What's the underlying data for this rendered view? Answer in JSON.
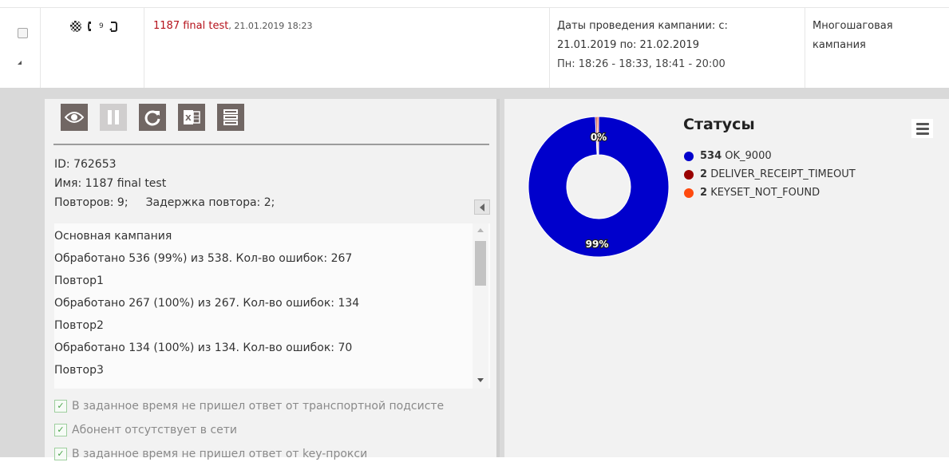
{
  "row": {
    "repeat_icon_count": "9",
    "campaign_name": "1187 final test",
    "campaign_date": "21.01.2019 18:23",
    "dates_line1": "Даты проведения кампании: с:",
    "dates_line2": "21.01.2019 по: 21.02.2019",
    "dates_line3": "Пн: 18:26 - 18:33, 18:41 - 20:00",
    "type_line1": "Многошаговая",
    "type_line2": "кампания"
  },
  "info": {
    "id": "ID: 762653",
    "name": "Имя: 1187 final test",
    "repeats": "Повторов: 9;",
    "delay": "Задержка повтора: 2;"
  },
  "log": [
    "Основная кампания",
    "Обработано 536 (99%) из 538. Кол-во ошибок: 267",
    "Повтор1",
    "Обработано 267 (100%) из 267. Кол-во ошибок: 134",
    "Повтор2",
    "Обработано 134 (100%) из 134. Кол-во ошибок: 70",
    "Повтор3"
  ],
  "errors": [
    "В заданное время не пришел ответ от транспортной подсисте",
    "Абонент отсутствует в сети",
    "В заданное время не пришел ответ от key-прокси"
  ],
  "colors": {
    "ok": "#0000cc",
    "timeout": "#990000",
    "keyset": "#ff4a0e",
    "campaign_name": "#b5121b"
  },
  "chart_data": {
    "type": "pie",
    "title": "Статусы",
    "series": [
      {
        "name": "OK_9000",
        "value": 534,
        "color": "#0000cc"
      },
      {
        "name": "DELIVER_RECEIPT_TIMEOUT",
        "value": 2,
        "color": "#990000"
      },
      {
        "name": "KEYSET_NOT_FOUND",
        "value": 2,
        "color": "#ff4a0e"
      }
    ],
    "data_labels": [
      "99%",
      "0%"
    ],
    "legend_position": "top-right"
  }
}
